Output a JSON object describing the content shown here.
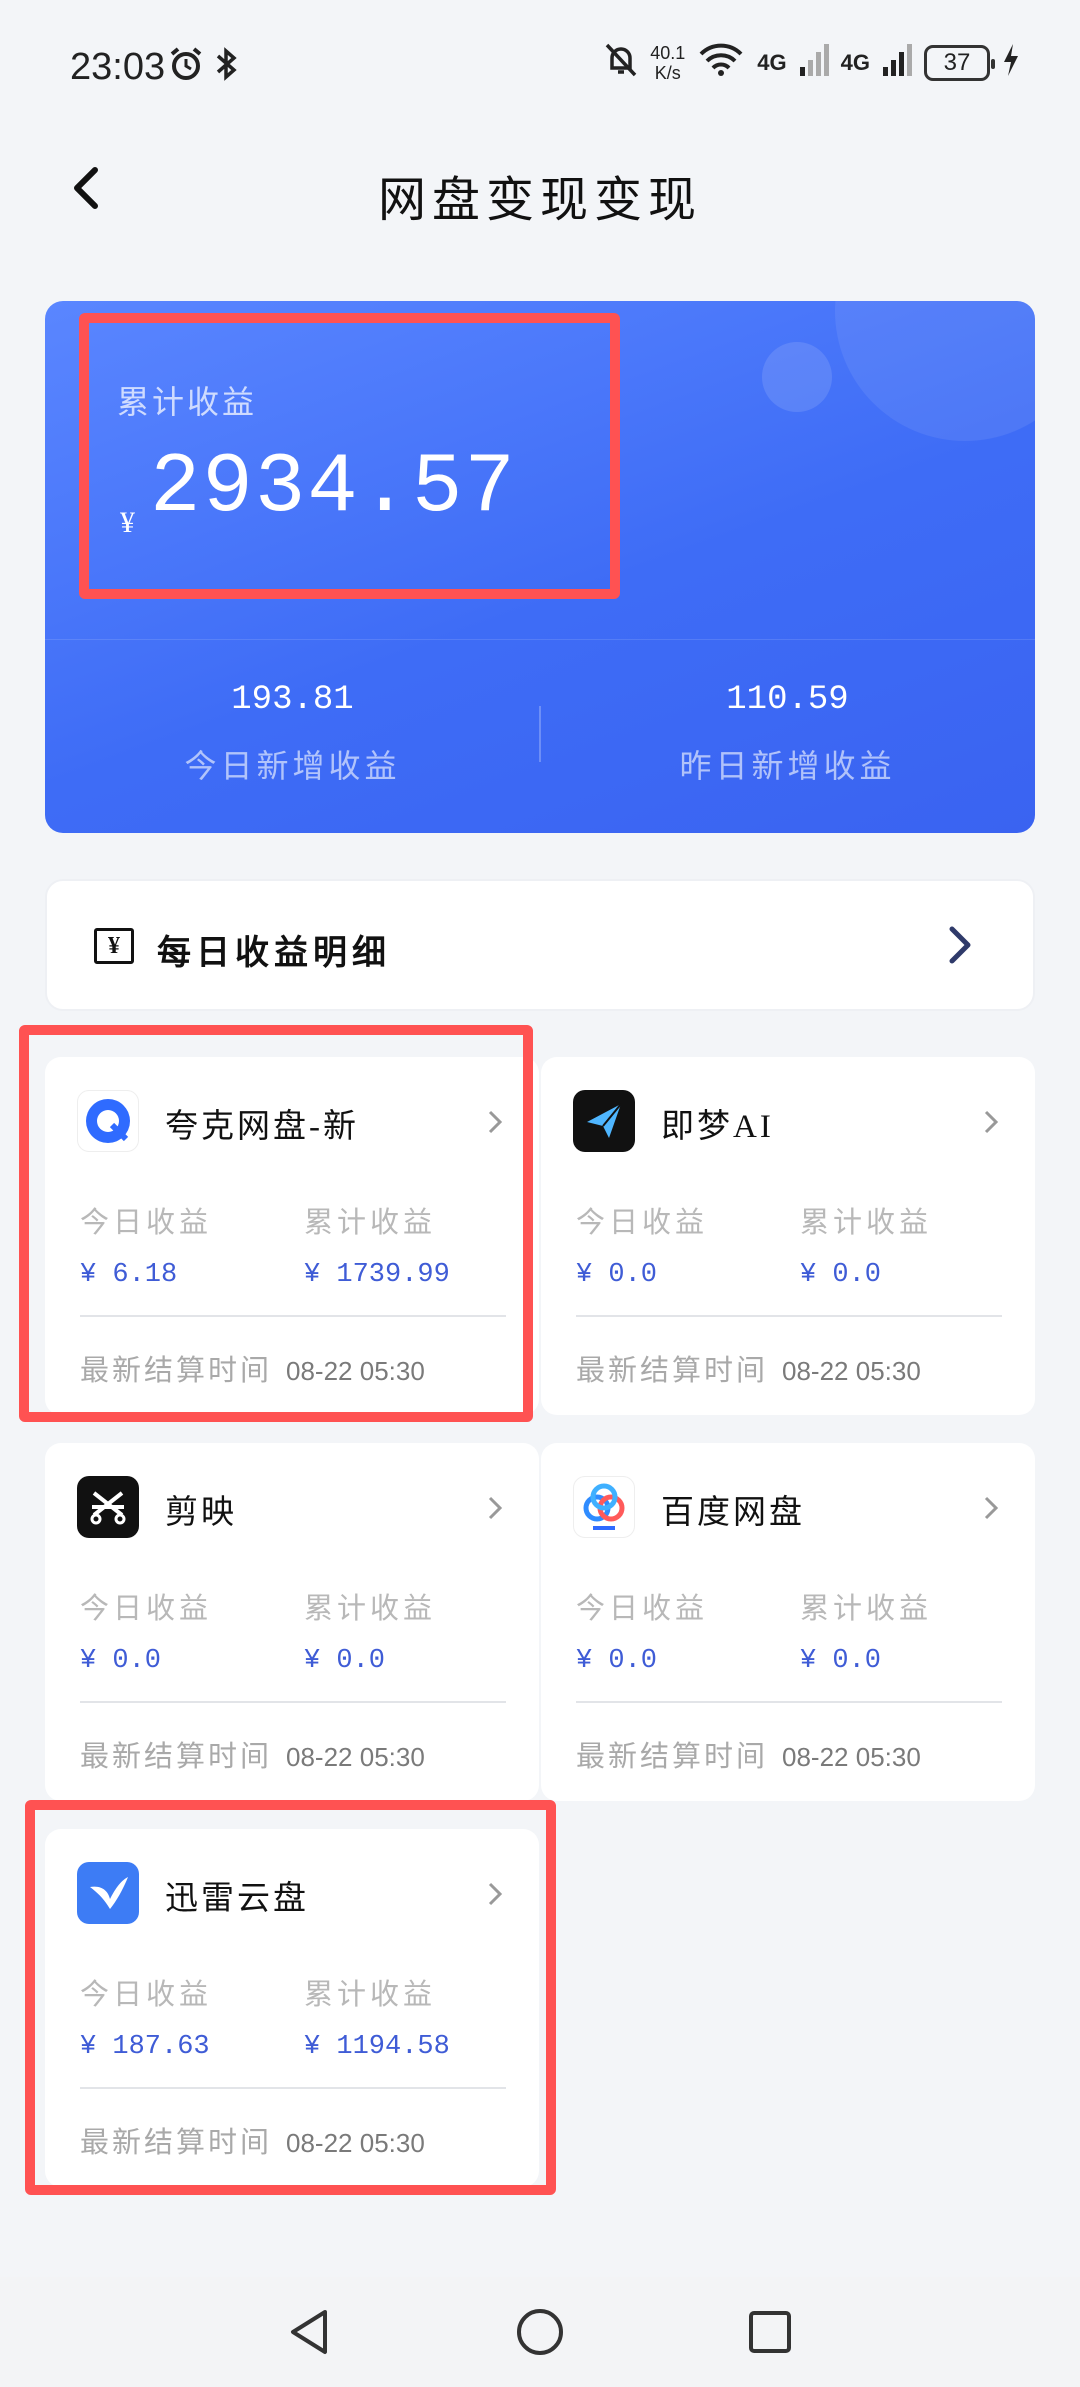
{
  "status_bar": {
    "time": "23:03",
    "speed_value": "40.1",
    "speed_unit": "K/s",
    "net1": "4G",
    "net2": "4G",
    "battery": "37",
    "icons": [
      "alarm-icon",
      "bluetooth-icon",
      "mute-icon",
      "wifi-icon",
      "signal-icon",
      "charging-icon"
    ]
  },
  "header": {
    "title": "网盘变现变现",
    "back_icon": "chevron-left-icon"
  },
  "summary": {
    "total_label": "累计收益",
    "currency": "¥",
    "total_value": "2934.57",
    "today_value": "193.81",
    "today_label": "今日新增收益",
    "yesterday_value": "110.59",
    "yesterday_label": "昨日新增收益"
  },
  "daily_detail": {
    "label": "每日收益明细",
    "icon": "yen-receipt-icon"
  },
  "apps": [
    {
      "name": "夸克网盘-新",
      "today_label": "今日收益",
      "total_label": "累计收益",
      "today_value": "¥ 6.18",
      "total_value": "¥ 1739.99",
      "settle_label": "最新结算时间",
      "settle_time": "08-22 05:30"
    },
    {
      "name": "即梦AI",
      "today_label": "今日收益",
      "total_label": "累计收益",
      "today_value": "¥ 0.0",
      "total_value": "¥ 0.0",
      "settle_label": "最新结算时间",
      "settle_time": "08-22 05:30"
    },
    {
      "name": "剪映",
      "today_label": "今日收益",
      "total_label": "累计收益",
      "today_value": "¥ 0.0",
      "total_value": "¥ 0.0",
      "settle_label": "最新结算时间",
      "settle_time": "08-22 05:30"
    },
    {
      "name": "百度网盘",
      "today_label": "今日收益",
      "total_label": "累计收益",
      "today_value": "¥ 0.0",
      "total_value": "¥ 0.0",
      "settle_label": "最新结算时间",
      "settle_time": "08-22 05:30"
    },
    {
      "name": "迅雷云盘",
      "today_label": "今日收益",
      "total_label": "累计收益",
      "today_value": "¥ 187.63",
      "total_value": "¥ 1194.58",
      "settle_label": "最新结算时间",
      "settle_time": "08-22 05:30"
    }
  ],
  "colors": {
    "hero_blue": "#3e6cf6",
    "value_blue": "#3f5cd6",
    "highlight_red": "#ff5252"
  },
  "nav": [
    "back-nav-icon",
    "home-nav-icon",
    "recents-nav-icon"
  ]
}
